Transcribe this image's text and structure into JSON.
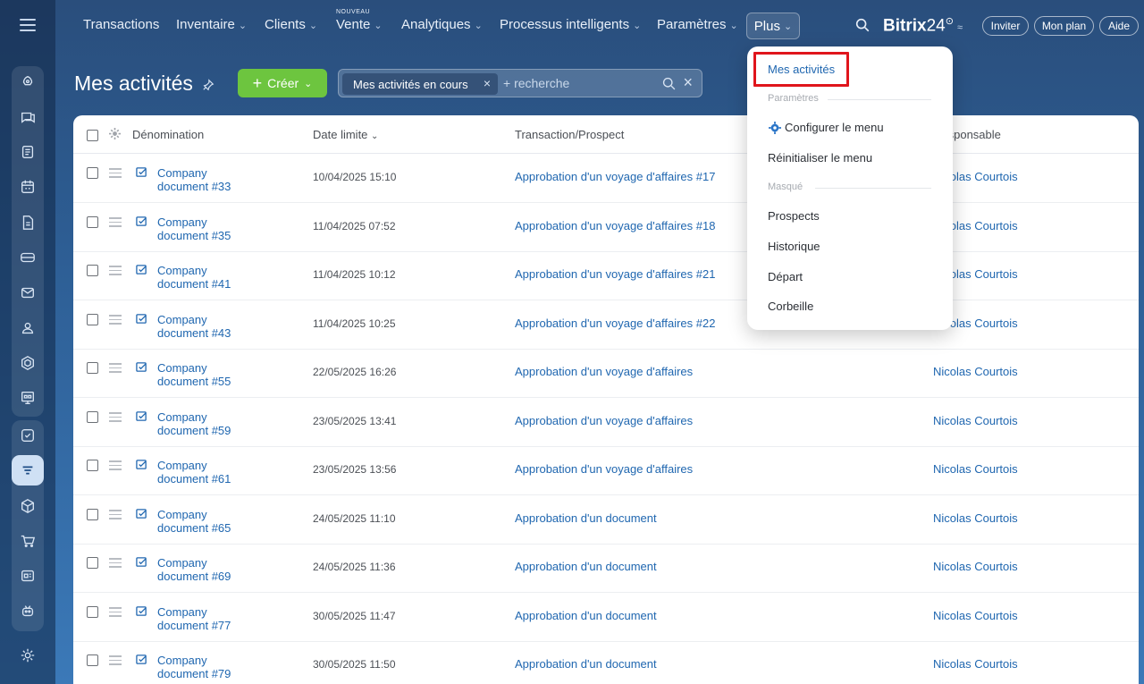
{
  "nav": {
    "items": [
      {
        "label": "Transactions",
        "has_chevron": false
      },
      {
        "label": "Inventaire",
        "has_chevron": true
      },
      {
        "label": "Clients",
        "has_chevron": true
      },
      {
        "label": "Vente",
        "has_chevron": true,
        "badge": "NOUVEAU"
      },
      {
        "label": "Analytiques",
        "has_chevron": true
      },
      {
        "label": "Processus intelligents",
        "has_chevron": true
      },
      {
        "label": "Paramètres",
        "has_chevron": true
      }
    ],
    "more_label": "Plus",
    "chevron": "⌄",
    "brand_name": "Bitrix",
    "brand_num": "24",
    "brand_clock": "⊙",
    "brand_wave": "≈",
    "invite_label": "Inviter",
    "plan_label": "Mon plan",
    "help_label": "Aide"
  },
  "sidebar": {
    "icons": [
      "menu-icon",
      "rocket-icon",
      "chat-icon",
      "feed-icon",
      "calendar-icon",
      "document-icon",
      "drive-icon",
      "mail-icon",
      "group-icon",
      "hex-icon",
      "board-icon",
      "tasks-icon",
      "crm-icon",
      "inventory-icon",
      "cart-icon",
      "sites-icon",
      "robot-icon",
      "settings-icon"
    ]
  },
  "toolbar": {
    "title": "Mes activités",
    "create_label": "Créer",
    "create_plus": "+",
    "create_chevron": "⌄",
    "filter_chip": "Mes activités en cours",
    "chip_close": "×",
    "search_placeholder": "+ recherche",
    "clear": "×"
  },
  "table": {
    "headers": {
      "name": "Dénomination",
      "date": "Date limite",
      "date_sort": "⌄",
      "deal": "Transaction/Prospect",
      "resp": "Responsable"
    },
    "rows": [
      {
        "name_line1": "Company",
        "name_line2": "document #33",
        "date": "10/04/2025 15:10",
        "deal": "Approbation d'un voyage d'affaires #17",
        "resp": "Nicolas Courtois"
      },
      {
        "name_line1": "Company",
        "name_line2": "document #35",
        "date": "11/04/2025 07:52",
        "deal": "Approbation d'un voyage d'affaires #18",
        "resp": "Nicolas Courtois"
      },
      {
        "name_line1": "Company",
        "name_line2": "document #41",
        "date": "11/04/2025 10:12",
        "deal": "Approbation d'un voyage d'affaires #21",
        "resp": "Nicolas Courtois"
      },
      {
        "name_line1": "Company",
        "name_line2": "document #43",
        "date": "11/04/2025 10:25",
        "deal": "Approbation d'un voyage d'affaires #22",
        "resp": "Nicolas Courtois"
      },
      {
        "name_line1": "Company",
        "name_line2": "document #55",
        "date": "22/05/2025 16:26",
        "deal": "Approbation d'un voyage d'affaires",
        "resp": "Nicolas Courtois"
      },
      {
        "name_line1": "Company",
        "name_line2": "document #59",
        "date": "23/05/2025 13:41",
        "deal": "Approbation d'un voyage d'affaires",
        "resp": "Nicolas Courtois"
      },
      {
        "name_line1": "Company",
        "name_line2": "document #61",
        "date": "23/05/2025 13:56",
        "deal": "Approbation d'un voyage d'affaires",
        "resp": "Nicolas Courtois"
      },
      {
        "name_line1": "Company",
        "name_line2": "document #65",
        "date": "24/05/2025 11:10",
        "deal": "Approbation d'un document",
        "resp": "Nicolas Courtois"
      },
      {
        "name_line1": "Company",
        "name_line2": "document #69",
        "date": "24/05/2025 11:36",
        "deal": "Approbation d'un document",
        "resp": "Nicolas Courtois"
      },
      {
        "name_line1": "Company",
        "name_line2": "document #77",
        "date": "30/05/2025 11:47",
        "deal": "Approbation d'un document",
        "resp": "Nicolas Courtois"
      },
      {
        "name_line1": "Company",
        "name_line2": "document #79",
        "date": "30/05/2025 11:50",
        "deal": "Approbation d'un document",
        "resp": "Nicolas Courtois"
      }
    ]
  },
  "menu": {
    "my_activities": "Mes activités",
    "section_settings": "Paramètres",
    "configure": "Configurer le menu",
    "reset": "Réinitialiser le menu",
    "section_hidden": "Masqué",
    "hidden_items": [
      "Prospects",
      "Historique",
      "Départ",
      "Corbeille"
    ]
  },
  "colors": {
    "accent": "#2067b0",
    "create_button": "#6dc53f",
    "highlight": "#e0151c"
  }
}
